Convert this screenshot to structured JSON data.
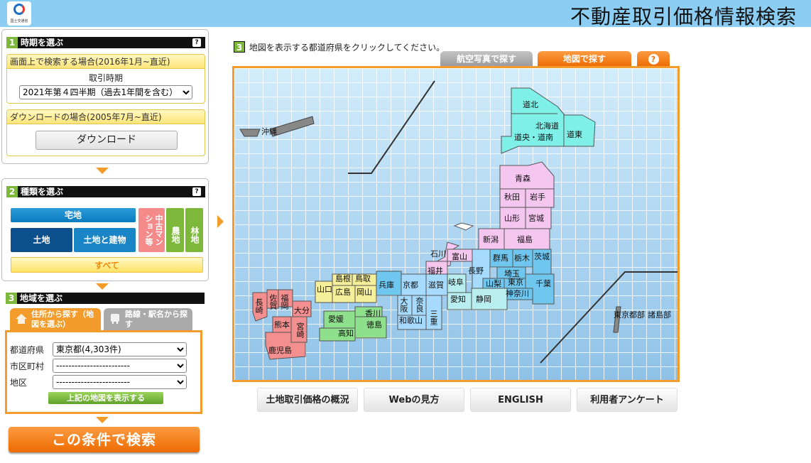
{
  "header": {
    "title": "不動産取引価格情報検索",
    "logo_caption": "国土交通省"
  },
  "step1": {
    "number": "1",
    "title": "時期を選ぶ",
    "help": "?",
    "onscreen_label": "画面上で検索する場合(2016年1月~直近)",
    "period_label": "取引時期",
    "period_selected": "2021年第４四半期（過去1年間を含む）",
    "download_label": "ダウンロードの場合(2005年7月~直近)",
    "download_button": "ダウンロード"
  },
  "step2": {
    "number": "2",
    "title": "種類を選ぶ",
    "help": "?",
    "residential": "宅地",
    "land": "土地",
    "land_building": "土地と建物",
    "condo": "中古マンション等",
    "farmland": "農地",
    "forest": "林地",
    "all": "すべて"
  },
  "step3": {
    "number": "3",
    "title": "地域を選ぶ",
    "tab_address": "住所から探す（地図を選ぶ）",
    "tab_line": "路線・駅名から探す",
    "pref_label": "都道府県",
    "pref_selected": "東京都(4,303件)",
    "city_label": "市区町村",
    "city_selected": "------------------------",
    "district_label": "地区",
    "district_selected": "------------------------",
    "show_map_button": "上記の地図を表示する"
  },
  "search_button": "この条件で検索",
  "map_panel": {
    "number": "3",
    "instruction": "地図を表示する都道府県をクリックしてください。",
    "tab_aerial": "航空写真で探す",
    "tab_map": "地図で探す",
    "help": "?",
    "labels": {
      "doboku": "道北",
      "hokkaido": "北海道",
      "dochuo": "道央・道南",
      "doto": "道東",
      "aomori": "青森",
      "akita": "秋田",
      "iwate": "岩手",
      "yamagata": "山形",
      "miyagi": "宮城",
      "niigata": "新潟",
      "fukushima": "福島",
      "ishikawa": "石川",
      "toyama": "富山",
      "nagano": "長野",
      "gunma": "群馬",
      "tochigi": "栃木",
      "ibaraki": "茨城",
      "fukui": "福井",
      "saitama": "埼玉",
      "gifu": "岐阜",
      "shiga": "滋賀",
      "kyoto": "京都",
      "hyogo": "兵庫",
      "tottori": "鳥取",
      "shimane": "島根",
      "yamaguchi": "山口",
      "hiroshima": "広島",
      "okayama": "岡山",
      "yamanashi": "山梨",
      "tokyo": "東京",
      "chiba": "千葉",
      "kanagawa": "神奈川",
      "aichi": "愛知",
      "shizuoka": "静岡",
      "mie": "三重",
      "nara": "奈良",
      "osaka": "大阪",
      "wakayama": "和歌山",
      "kagawa": "香川",
      "ehime": "愛媛",
      "tokushima": "徳島",
      "kochi": "高知",
      "fukuoka": "福岡",
      "saga": "佐賀",
      "nagasaki": "長崎",
      "oita": "大分",
      "kumamoto": "熊本",
      "miyazaki": "宮崎",
      "kagoshima": "鹿児島",
      "okinawa": "沖縄",
      "tokyo_islands": "東京都部",
      "islands": "諸島部"
    }
  },
  "bottom_links": [
    "土地取引価格の概況",
    "Webの見方",
    "ENGLISH",
    "利用者アンケート"
  ],
  "colors": {
    "accent_orange": "#f39c2c",
    "header_blue": "#8ccdf3",
    "hokkaido": "#7ef0e8",
    "tohoku": "#f5c6f0",
    "kanto": "#6fc7f0",
    "chubu": "#b9eef0",
    "kinki": "#a6dbff",
    "chugoku": "#f5ef9a",
    "shikoku": "#8fe08c",
    "kyushu": "#f38f8f",
    "step_green": "#7db83a"
  }
}
